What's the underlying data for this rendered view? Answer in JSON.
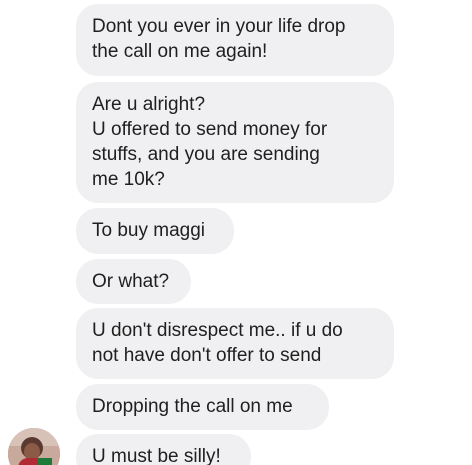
{
  "conversation": {
    "messages": [
      {
        "text": "Dont you ever in your life drop\nthe call on me again!"
      },
      {
        "text": "Are u alright?\nU offered to send money for\nstuffs, and you are sending\nme 10k?"
      },
      {
        "text": "To buy maggi"
      },
      {
        "text": "Or what?"
      },
      {
        "text": "U don't disrespect me.. if u do\nnot have don't offer to send"
      },
      {
        "text": "Dropping the call on me"
      },
      {
        "text": "U must be silly!"
      }
    ]
  },
  "colors": {
    "bubble_background": "#f0f0f2",
    "text": "#1f1f1f",
    "page_background": "#ffffff"
  },
  "icons": {
    "sender_avatar": "contact-avatar-photo"
  }
}
